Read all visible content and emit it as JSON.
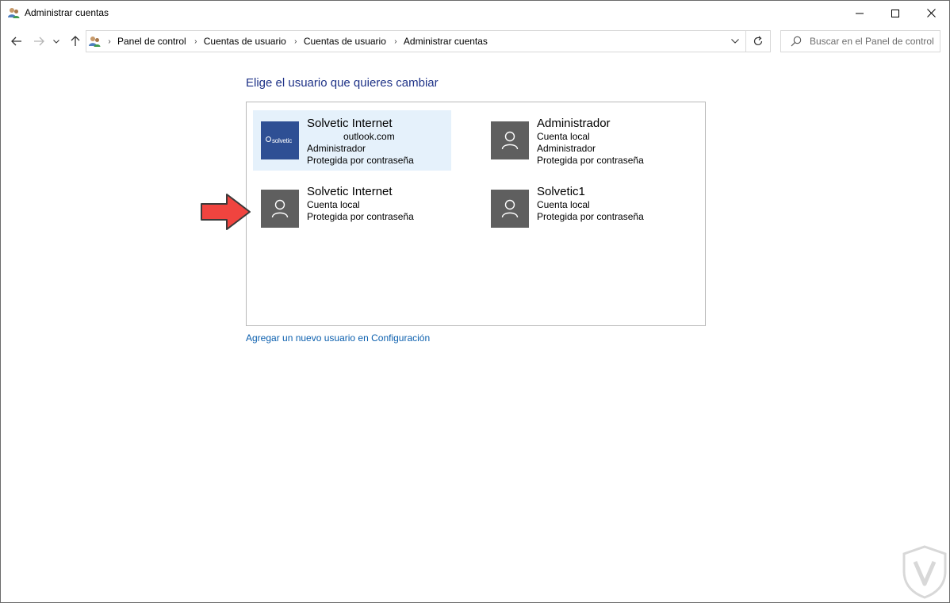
{
  "window": {
    "title": "Administrar cuentas",
    "icon": "users-control-panel-icon"
  },
  "address": {
    "crumbs": [
      "Panel de control",
      "Cuentas de usuario",
      "Cuentas de usuario",
      "Administrar cuentas"
    ]
  },
  "search": {
    "placeholder": "Buscar en el Panel de control"
  },
  "main": {
    "heading": "Elige el usuario que quieres cambiar",
    "accounts": [
      {
        "name": "Solvetic Internet",
        "lines": [
          "outlook.com",
          "Administrador",
          "Protegida por contraseña"
        ],
        "avatar_text": "solvetic",
        "selected": true
      },
      {
        "name": "Administrador",
        "lines": [
          "Cuenta local",
          "Administrador",
          "Protegida por contraseña"
        ],
        "selected": false
      },
      {
        "name": "Solvetic Internet",
        "lines": [
          "Cuenta local",
          "Protegida por contraseña"
        ],
        "selected": false
      },
      {
        "name": "Solvetic1",
        "lines": [
          "Cuenta local",
          "Protegida por contraseña"
        ],
        "selected": false
      }
    ],
    "add_user_link": "Agregar un nuevo usuario en Configuración"
  },
  "colors": {
    "heading": "#1e3287",
    "link": "#0b5fae",
    "selected_tile": "#e5f1fb",
    "avatar_gray": "#5f5f5f",
    "arrow_red": "#f0443f"
  }
}
